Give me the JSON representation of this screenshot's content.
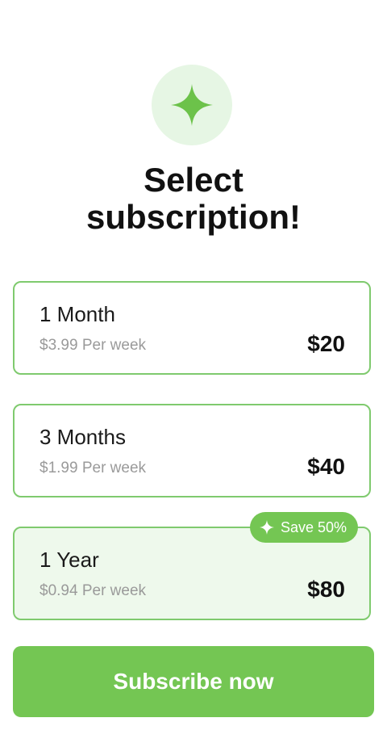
{
  "header": {
    "icon": "sparkle-icon",
    "title": "Select\nsubscription!"
  },
  "plans": [
    {
      "name": "1 Month",
      "per_week": "$3.99 Per week",
      "price": "$20"
    },
    {
      "name": "3 Months",
      "per_week": "$1.99 Per week",
      "price": "$40"
    },
    {
      "name": "1 Year",
      "per_week": "$0.94 Per week",
      "price": "$80",
      "badge": "Save 50%"
    }
  ],
  "cta": {
    "label": "Subscribe now"
  },
  "colors": {
    "accent": "#74c653",
    "accent_light": "#e6f6e4",
    "card_border": "#7fca6e",
    "selected_bg": "#eef9ec"
  }
}
